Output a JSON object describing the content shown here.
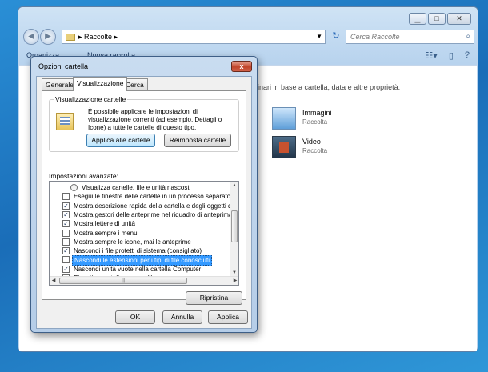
{
  "explorer": {
    "breadcrumb": "Raccolte",
    "search_placeholder": "Cerca Raccolte",
    "toolbar": {
      "organize": "Organizza",
      "new_library": "Nuova raccolta"
    },
    "hint": "linari in base a cartella, data e altre proprietà.",
    "libraries": [
      {
        "name": "Immagini",
        "type": "Raccolta"
      },
      {
        "name": "Video",
        "type": "Raccolta"
      }
    ]
  },
  "dialog": {
    "title": "Opzioni cartella",
    "close_glyph": "x",
    "tabs": [
      "Generale",
      "Visualizzazione",
      "Cerca"
    ],
    "folder_views": {
      "group_label": "Visualizzazione cartelle",
      "description": "È possibile applicare le impostazioni di visualizzazione correnti (ad esempio, Dettagli o Icone) a tutte le cartelle di questo tipo.",
      "apply_button": "Applica alle cartelle",
      "reset_button": "Reimposta cartelle"
    },
    "advanced_label": "Impostazioni avanzate:",
    "settings": [
      {
        "text": "Visualizza cartelle, file e unità nascosti",
        "kind": "radio",
        "checked": false
      },
      {
        "text": "Esegui le finestre delle cartelle in un processo separato",
        "kind": "checkbox",
        "checked": false
      },
      {
        "text": "Mostra descrizione rapida della cartella e degli oggetti del",
        "kind": "checkbox",
        "checked": true
      },
      {
        "text": "Mostra gestori delle anteprime nel riquadro di anteprima",
        "kind": "checkbox",
        "checked": true
      },
      {
        "text": "Mostra lettere di unità",
        "kind": "checkbox",
        "checked": true
      },
      {
        "text": "Mostra sempre i menu",
        "kind": "checkbox",
        "checked": false
      },
      {
        "text": "Mostra sempre le icone, mai le anteprime",
        "kind": "checkbox",
        "checked": false
      },
      {
        "text": "Nascondi i file protetti di sistema (consigliato)",
        "kind": "checkbox",
        "checked": true
      },
      {
        "text": "Nascondi le estensioni per i tipi di file conosciuti",
        "kind": "checkbox",
        "checked": false,
        "selected": true
      },
      {
        "text": "Nascondi unità vuote nella cartella Computer",
        "kind": "checkbox",
        "checked": true
      },
      {
        "text": "Ripristina cartelle aperte all'accesso",
        "kind": "checkbox",
        "checked": false
      }
    ],
    "check_glyph": "✓",
    "restore_button": "Ripristina",
    "ok_button": "OK",
    "cancel_button": "Annulla",
    "apply_button": "Applica"
  }
}
